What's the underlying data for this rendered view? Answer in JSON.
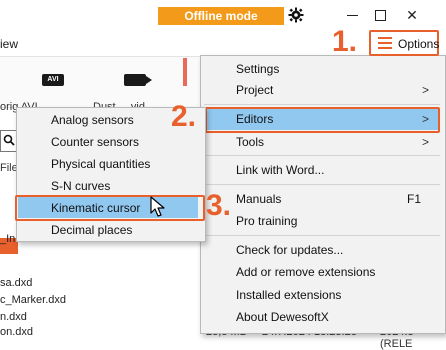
{
  "titlebar": {
    "offline_badge": "Offline mode",
    "gear_icon": "gear-icon",
    "minimize_icon": "minimize-icon",
    "maximize_icon": "maximize-icon",
    "close_glyph": "✕"
  },
  "menubar": {
    "view_label": "iew"
  },
  "toolbar": {
    "avi_icon_text": "AVI",
    "label_1": "orig  AVI",
    "label_2": "Dust...  .vid"
  },
  "file_panel": {
    "header": "File",
    "files": [
      "_In",
      "sa.dxd",
      "c_Marker.dxd",
      "n.dxd",
      "on.dxd"
    ]
  },
  "bottom_row": {
    "size": "28,8 MB",
    "date": "24.7.2024 13:23:28",
    "version": "2024.3 (RELE"
  },
  "options": {
    "label": "Options",
    "icon": "hamburger-icon"
  },
  "steps": {
    "one": "1.",
    "two": "2.",
    "three": "3."
  },
  "main_menu": {
    "settings": "Settings",
    "project": "Project",
    "editors": "Editors",
    "tools": "Tools",
    "link_word": "Link with Word...",
    "manuals": "Manuals",
    "manuals_shortcut": "F1",
    "pro_training": "Pro training",
    "check_updates": "Check for updates...",
    "add_remove_ext": "Add or remove extensions",
    "installed_ext": "Installed extensions",
    "about": "About DewesoftX",
    "arrow": ">"
  },
  "sub_menu": {
    "analog": "Analog sensors",
    "counter": "Counter sensors",
    "physical": "Physical quantities",
    "sn": "S-N curves",
    "kinematic": "Kinematic cursor",
    "decimal": "Decimal places"
  },
  "colors": {
    "accent_orange": "#e8602c",
    "badge_orange": "#f49a1a",
    "highlight_blue": "#91c8f0"
  }
}
